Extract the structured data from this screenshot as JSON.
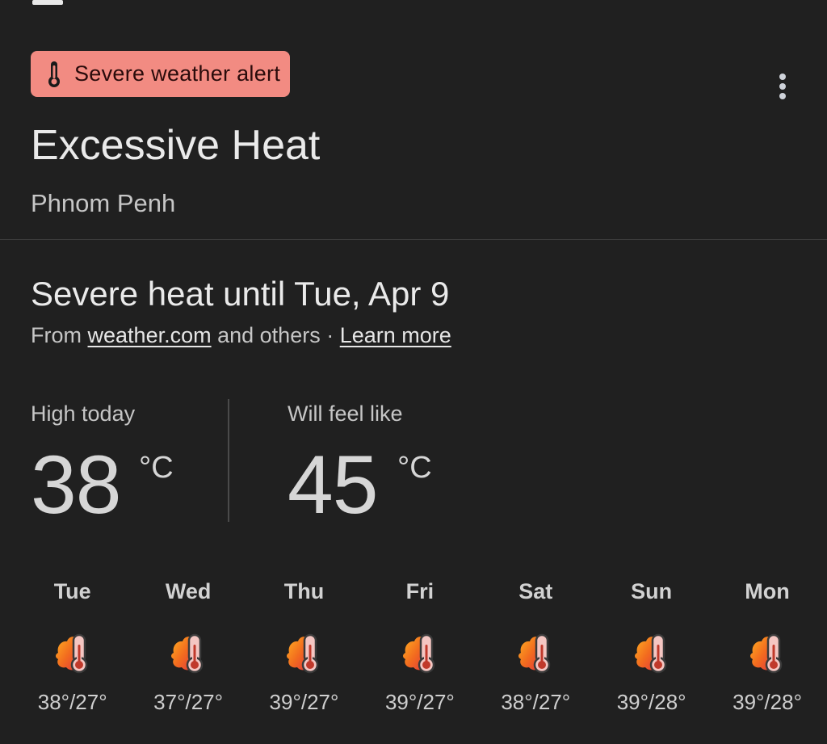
{
  "alert": {
    "label": "Severe weather alert",
    "icon": "thermometer-icon",
    "background": "#f28b82"
  },
  "more": {
    "icon": "more-vertical-icon"
  },
  "title": "Excessive Heat",
  "location": "Phnom Penh",
  "headline": "Severe heat until Tue, Apr 9",
  "source": {
    "prefix": "From",
    "link": "weather.com",
    "middle": "and others ·",
    "learn_more": "Learn more"
  },
  "high_today": {
    "label": "High today",
    "value": "38",
    "unit": "°C"
  },
  "feels_like": {
    "label": "Will feel like",
    "value": "45",
    "unit": "°C"
  },
  "forecast": [
    {
      "day": "Tue",
      "temps": "38°/27°",
      "icon": "heat-thermometer-icon"
    },
    {
      "day": "Wed",
      "temps": "37°/27°",
      "icon": "heat-thermometer-icon"
    },
    {
      "day": "Thu",
      "temps": "39°/27°",
      "icon": "heat-thermometer-icon"
    },
    {
      "day": "Fri",
      "temps": "39°/27°",
      "icon": "heat-thermometer-icon"
    },
    {
      "day": "Sat",
      "temps": "38°/27°",
      "icon": "heat-thermometer-icon"
    },
    {
      "day": "Sun",
      "temps": "39°/28°",
      "icon": "heat-thermometer-icon"
    },
    {
      "day": "Mon",
      "temps": "39°/28°",
      "icon": "heat-thermometer-icon"
    }
  ],
  "colors": {
    "background": "#202020",
    "heat_orange": "#f57c1f",
    "heat_red": "#e8493a"
  }
}
